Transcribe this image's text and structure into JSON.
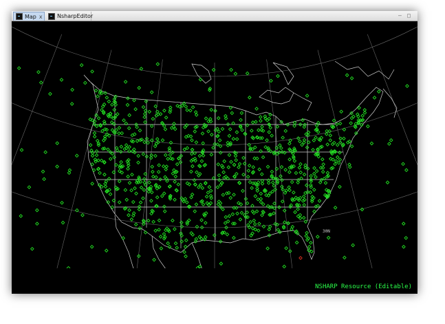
{
  "tabs": [
    {
      "label": "Map",
      "close": "x",
      "icon": "map-editor-icon",
      "active": true
    },
    {
      "label": "NsharpEditor",
      "icon": "nsharp-editor-icon",
      "active": false
    }
  ],
  "window_controls": {
    "minimize": "–",
    "maximize": "□"
  },
  "map": {
    "grid_label": "30N",
    "resource_label": "NSHARP Resource (Editable)",
    "station_color": "#22e222",
    "highlight_station_color": "#e03020",
    "boundary_color": "#cfcfcf",
    "background_color": "#000000"
  }
}
